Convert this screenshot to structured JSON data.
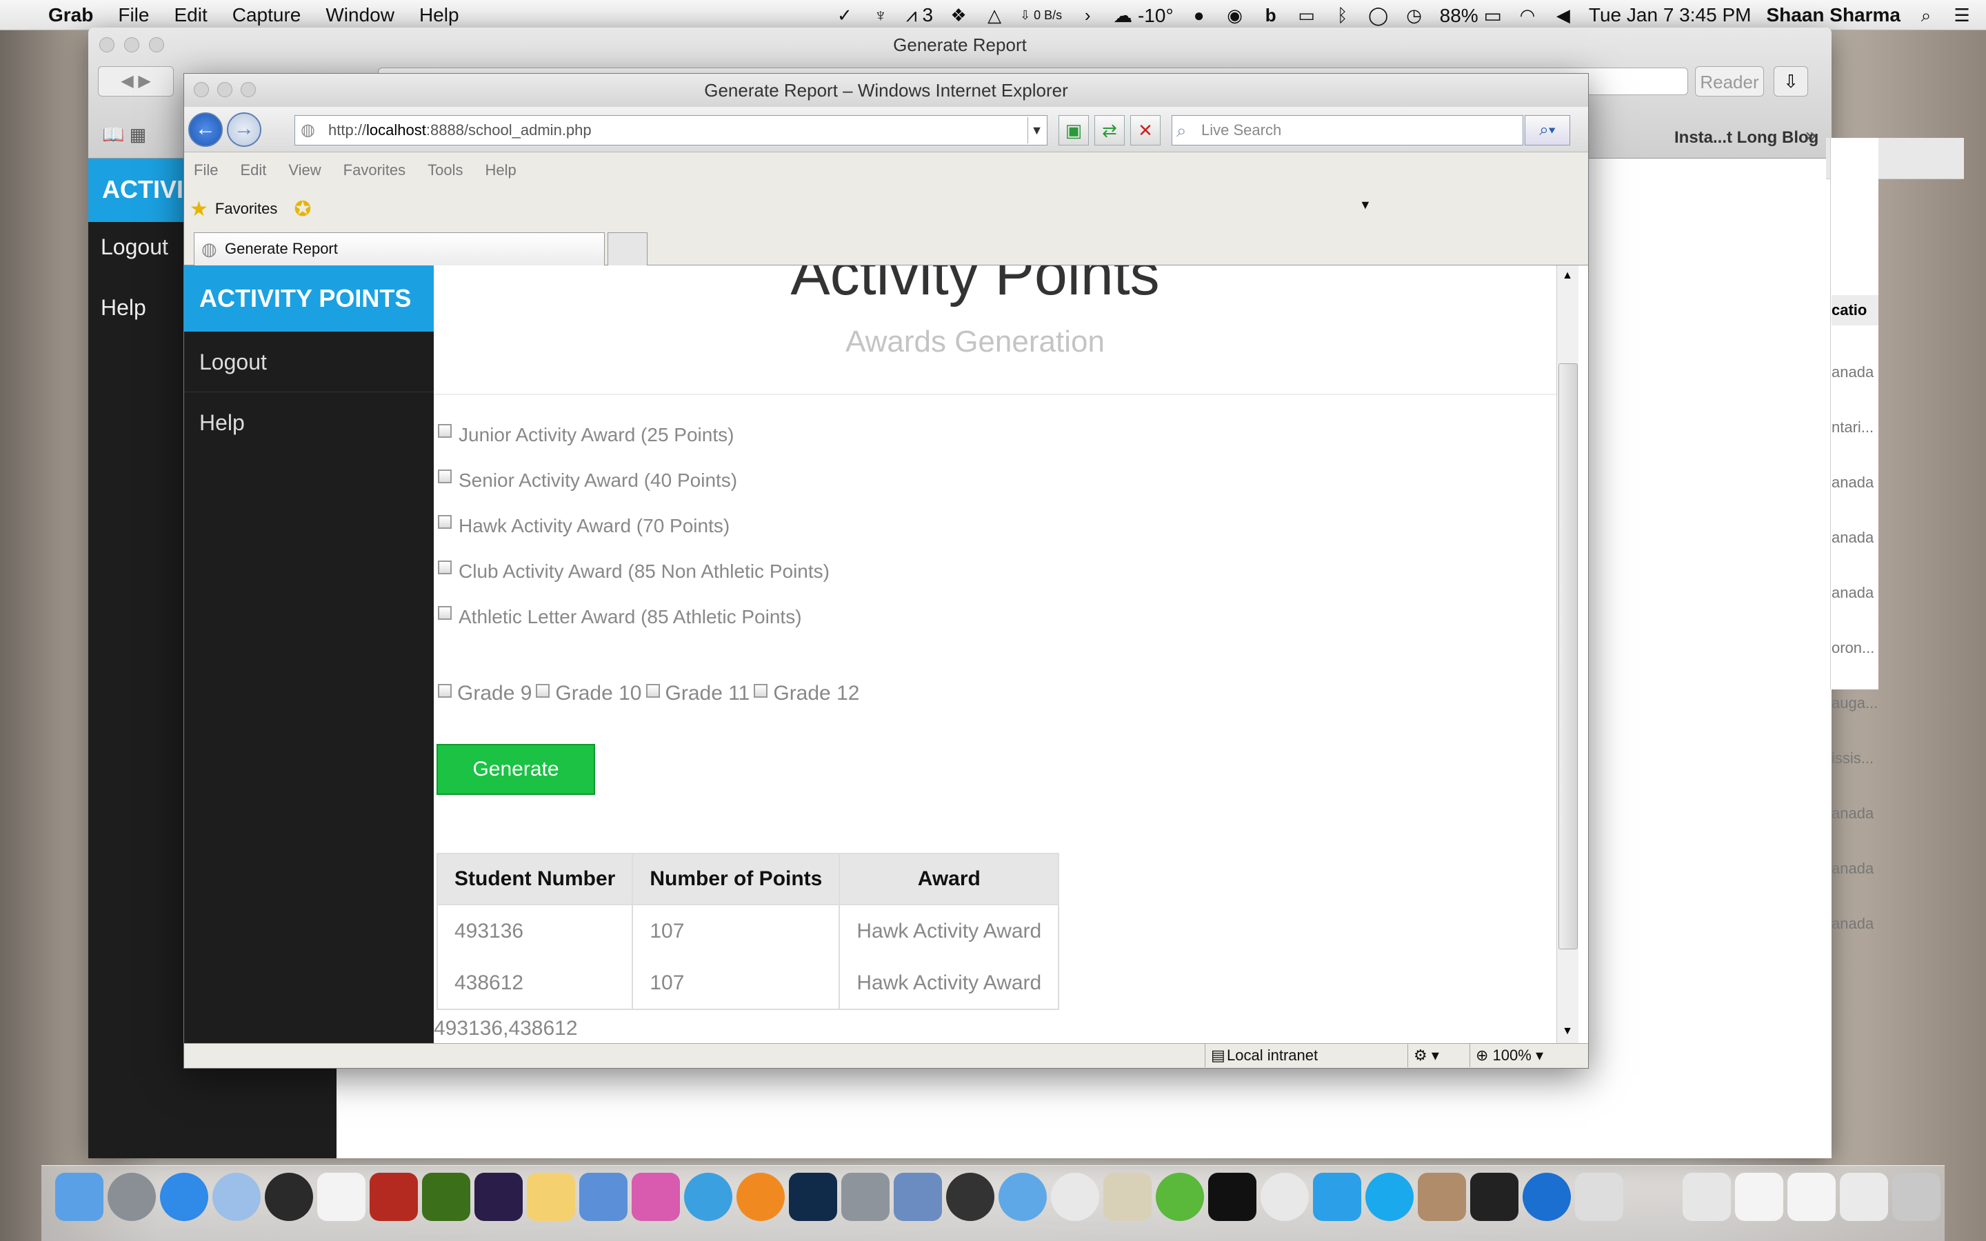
{
  "menubar": {
    "app": "Grab",
    "items": [
      "File",
      "Edit",
      "Capture",
      "Window",
      "Help"
    ],
    "right": {
      "adobe": "3",
      "net_speed": "0 B/s",
      "weather": "-10°",
      "battery": "88%",
      "datetime": "Tue Jan 7  3:45 PM",
      "user": "Shaan Sharma"
    }
  },
  "safari": {
    "title": "Generate Report",
    "reader": "Reader",
    "bookmark": "Insta...t Long Blog",
    "brand": "ACTIVI",
    "logout": "Logout",
    "help": "Help",
    "col_header": "catio",
    "side_items": [
      "anada",
      "ntari...",
      "anada",
      "anada",
      "anada",
      "oron...",
      "auga...",
      "issis...",
      "anada",
      "anada",
      "anada"
    ]
  },
  "ie": {
    "title": "Generate Report – Windows Internet Explorer",
    "url_prefix": "http://",
    "url_host": "localhost",
    "url_rest": ":8888/school_admin.php",
    "search_placeholder": "Live Search",
    "menu": [
      "File",
      "Edit",
      "View",
      "Favorites",
      "Tools",
      "Help"
    ],
    "favorites": "Favorites",
    "tab": "Generate Report",
    "status_zone": "Local intranet",
    "zoom": "100%"
  },
  "page": {
    "brand": "ACTIVITY POINTS",
    "nav": {
      "logout": "Logout",
      "help": "Help"
    },
    "heading": "Activity Points",
    "subheading": "Awards Generation",
    "awards": [
      "Junior Activity Award (25 Points)",
      "Senior Activity Award (40 Points)",
      "Hawk Activity Award (70 Points)",
      "Club Activity Award (85 Non Athletic Points)",
      "Athletic Letter Award (85 Athletic Points)"
    ],
    "grades": [
      "Grade 9",
      "Grade 10",
      "Grade 11",
      "Grade 12"
    ],
    "generate_label": "Generate",
    "table": {
      "headers": [
        "Student Number",
        "Number of Points",
        "Award"
      ],
      "rows": [
        [
          "493136",
          "107",
          "Hawk Activity Award"
        ],
        [
          "438612",
          "107",
          "Hawk Activity Award"
        ]
      ]
    },
    "ids_line": "493136,438612"
  },
  "colors": {
    "brand": "#1ba1e2",
    "generate": "#1bc244",
    "sidebar": "#1d1d1d"
  }
}
